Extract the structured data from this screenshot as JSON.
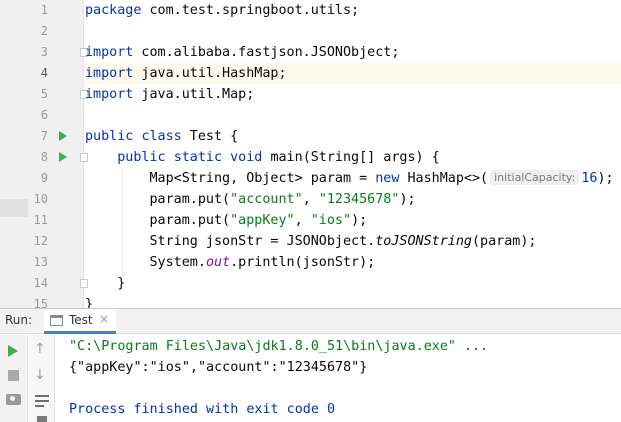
{
  "editor": {
    "line_numbers": [
      "1",
      "2",
      "3",
      "4",
      "5",
      "6",
      "7",
      "8",
      "9",
      "10",
      "11",
      "12",
      "13",
      "14",
      "15"
    ],
    "current_line": 4,
    "lines": {
      "l1": {
        "kw_package": "package",
        "text_package": " com.test.springboot.utils;"
      },
      "l3": {
        "kw_import": "import",
        "text": " com.alibaba.fastjson.JSONObject;"
      },
      "l4": {
        "kw_import": "import",
        "text": " java.util.HashMap;"
      },
      "l5": {
        "kw_import": "import",
        "text": " java.util.Map;"
      },
      "l7": {
        "kw_public": "public",
        "kw_class": "class",
        "text": " Test {"
      },
      "l8": {
        "kw_public": "public",
        "kw_static": "static",
        "kw_void": "void",
        "method": "main",
        "text": "(String[] args) {"
      },
      "l9": {
        "text_a": "Map<String, Object> param = ",
        "kw_new": "new",
        "text_b": " HashMap<>(",
        "hint": "initialCapacity:",
        "num": "16",
        "text_c": ");"
      },
      "l10": {
        "text_a": "param.put(",
        "str_a": "\"account\"",
        "text_b": ", ",
        "str_b": "\"12345678\"",
        "text_c": ");"
      },
      "l11": {
        "text_a": "param.put(",
        "str_a": "\"appKey\"",
        "text_b": ", ",
        "str_b": "\"ios\"",
        "text_c": ");"
      },
      "l12": {
        "text_a": "String jsonStr = JSONObject.",
        "italic": "toJSONString",
        "text_b": "(param);"
      },
      "l13": {
        "text_a": "System.",
        "static_field": "out",
        "text_b": ".println(jsonStr);"
      },
      "l14": {
        "text": "}"
      },
      "l15": {
        "text": "}"
      }
    }
  },
  "run_panel": {
    "label": "Run:",
    "tab_title": "Test",
    "tab_close": "×",
    "console": {
      "command": "\"C:\\Program Files\\Java\\jdk1.8.0_51\\bin\\java.exe\" ...",
      "output": "{\"appKey\":\"ios\",\"account\":\"12345678\"}",
      "exit": "Process finished with exit code 0"
    },
    "tools": {
      "up_arrow": "↑",
      "down_arrow": "↓"
    }
  },
  "icons": {
    "run_gutter": "run-arrow-icon",
    "fold": "fold-marker-icon",
    "rerun": "rerun-icon",
    "stop": "stop-icon",
    "camera": "camera-icon",
    "soft_wrap": "soft-wrap-icon"
  },
  "colors": {
    "keyword": "#0033b3",
    "string": "#067d17",
    "static_field": "#871094",
    "run_green": "#3fae4c",
    "current_line_bg": "#fcfaed",
    "tab_underline": "#4083c9"
  }
}
